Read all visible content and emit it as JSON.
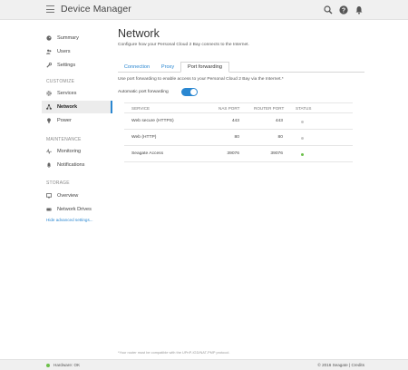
{
  "app": {
    "title": "Device Manager"
  },
  "topbar": {
    "icons": [
      "search-icon",
      "help-icon",
      "bell-icon"
    ]
  },
  "sidebar": {
    "items_top": [
      {
        "label": "Summary",
        "icon": "gauge-icon"
      },
      {
        "label": "Users",
        "icon": "users-icon"
      },
      {
        "label": "Settings",
        "icon": "wrench-icon"
      }
    ],
    "customize": {
      "title": "CUSTOMIZE",
      "items": [
        {
          "label": "Services",
          "icon": "gear-icon"
        },
        {
          "label": "Network",
          "icon": "network-icon",
          "active": true
        },
        {
          "label": "Power",
          "icon": "bulb-icon"
        }
      ]
    },
    "maintenance": {
      "title": "MAINTENANCE",
      "items": [
        {
          "label": "Monitoring",
          "icon": "pulse-icon"
        },
        {
          "label": "Notifications",
          "icon": "bell-icon"
        }
      ]
    },
    "storage": {
      "title": "STORAGE",
      "items": [
        {
          "label": "Overview",
          "icon": "monitor-icon"
        },
        {
          "label": "Network Drives",
          "icon": "drive-icon"
        }
      ]
    },
    "advanced_link": "Hide advanced settings..."
  },
  "main": {
    "title": "Network",
    "subtitle": "Configure how your Personal Cloud 2 Bay connects to the Internet.",
    "tabs": [
      {
        "label": "Connection"
      },
      {
        "label": "Proxy"
      },
      {
        "label": "Port forwarding",
        "active": true
      }
    ],
    "pf_description": "Use port forwarding to enable access to your Personal Cloud 2 Bay via the Internet.*",
    "auto_label": "Automatic port forwarding",
    "auto_enabled": true,
    "table": {
      "headers": [
        "SERVICE",
        "NAS PORT",
        "ROUTER PORT",
        "STATUS"
      ],
      "rows": [
        {
          "service": "Web secure (HTTPS)",
          "nas_port": "443",
          "router_port": "443",
          "status": "inactive"
        },
        {
          "service": "Web (HTTP)",
          "nas_port": "80",
          "router_port": "80",
          "status": "inactive"
        },
        {
          "service": "Seagate Access",
          "nas_port": "39076",
          "router_port": "39076",
          "status": "active"
        }
      ]
    },
    "footnote": "*Your router must be compatible with the UPnP-IGD/NAT-PMP protocol."
  },
  "statusbar": {
    "hardware": "Hardware: OK",
    "copyright": "© 2016 Seagate | Credits"
  },
  "colors": {
    "accent": "#2a87d1",
    "status_ok": "#6cc04a",
    "status_inactive": "#c8c8c8"
  }
}
